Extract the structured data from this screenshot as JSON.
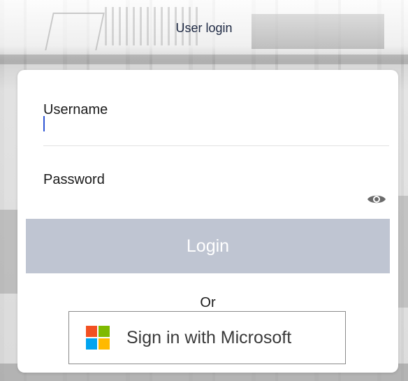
{
  "header": {
    "title": "User login"
  },
  "form": {
    "username_label": "Username",
    "username_value": "",
    "password_label": "Password",
    "password_value": "",
    "show_password_icon": "eye-icon",
    "login_label": "Login",
    "separator": "Or",
    "microsoft_label": "Sign in with Microsoft"
  },
  "colors": {
    "login_button_bg": "#bfc5d2",
    "ms_red": "#f25022",
    "ms_green": "#7fba00",
    "ms_blue": "#00a4ef",
    "ms_yellow": "#ffb900"
  }
}
